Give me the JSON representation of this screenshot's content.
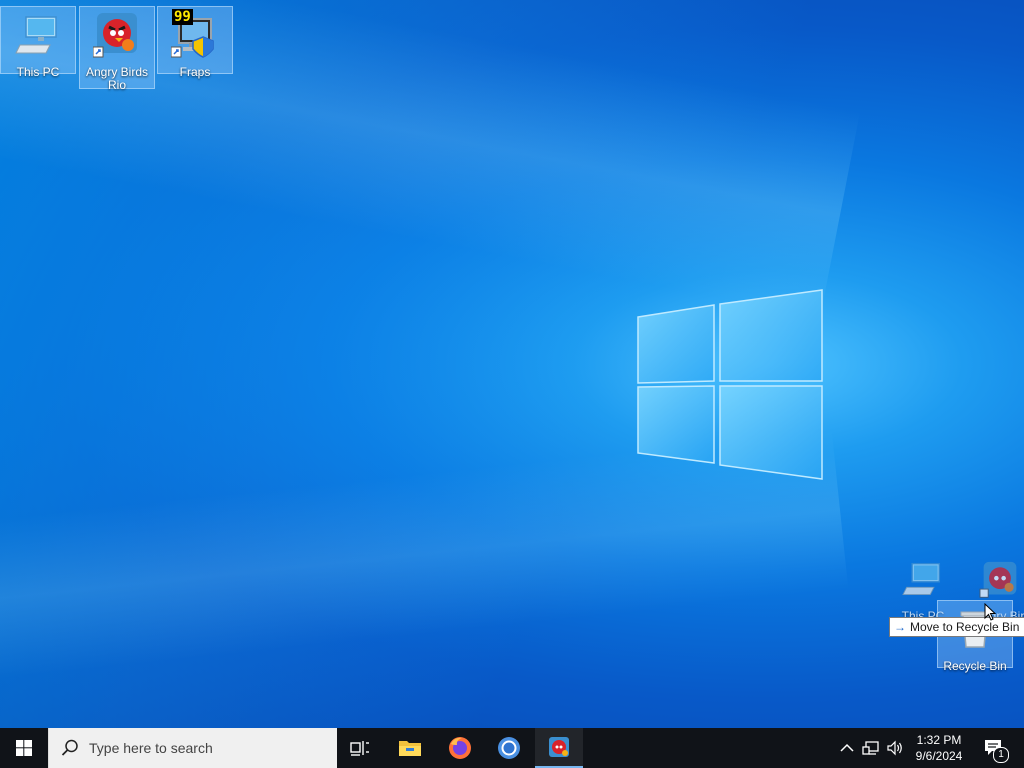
{
  "desktop": {
    "icons": [
      {
        "label": "This PC"
      },
      {
        "label": "Angry Birds Rio"
      },
      {
        "label": "Fraps"
      }
    ],
    "fraps_badge": "99",
    "drag_ghost": {
      "this_pc_label": "This PC",
      "angry_birds_label": "Angry Bird",
      "recycle_bin_label": "Recycle Bin"
    },
    "tooltip": {
      "arrow": "→",
      "text": "Move to Recycle Bin"
    }
  },
  "taskbar": {
    "search_placeholder": "Type here to search",
    "time": "1:32 PM",
    "date": "9/6/2024",
    "notification_count": "1",
    "pinned": [
      "task-view",
      "file-explorer",
      "firefox",
      "chrome",
      "angry-birds-rio"
    ]
  },
  "colors": {
    "taskbar_bg": "#101318",
    "accent": "#1763c9",
    "desktop_blue": "#0a78e0"
  }
}
